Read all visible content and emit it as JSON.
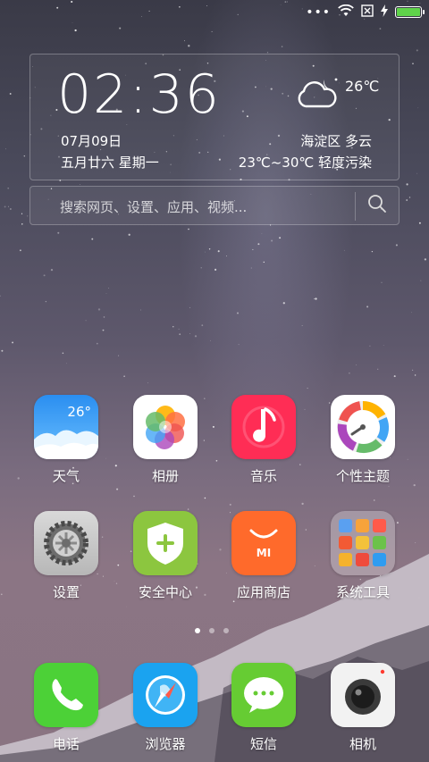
{
  "status_bar": {
    "dots": "•••",
    "icons": [
      "wifi-icon",
      "no-sim-icon",
      "charging-bolt-icon",
      "battery-icon"
    ],
    "battery_level": 1.0,
    "battery_color": "#5fd34a"
  },
  "clock_widget": {
    "time": "02:36",
    "date": "07月09日",
    "lunar_weekday": "五月廿六  星期一",
    "temperature_now": "26℃",
    "district_condition": "海淀区  多云",
    "range_air_quality": "23℃~30℃  轻度污染",
    "weather_icon": "cloudy-night-icon"
  },
  "search": {
    "placeholder": "搜索网页、设置、应用、视频...",
    "icon": "search-icon"
  },
  "apps_row1": [
    {
      "label": "天气",
      "icon": "weather-app-icon",
      "badge": "26°"
    },
    {
      "label": "相册",
      "icon": "gallery-app-icon"
    },
    {
      "label": "音乐",
      "icon": "music-app-icon"
    },
    {
      "label": "个性主题",
      "icon": "themes-app-icon"
    }
  ],
  "apps_row2": [
    {
      "label": "设置",
      "icon": "settings-app-icon"
    },
    {
      "label": "安全中心",
      "icon": "security-app-icon"
    },
    {
      "label": "应用商店",
      "icon": "app-store-icon",
      "badge": "MI"
    },
    {
      "label": "系统工具",
      "icon": "system-tools-folder-icon"
    }
  ],
  "page_indicator": {
    "pages": 3,
    "current": 1
  },
  "dock": [
    {
      "label": "电话",
      "icon": "phone-app-icon"
    },
    {
      "label": "浏览器",
      "icon": "browser-app-icon"
    },
    {
      "label": "短信",
      "icon": "messages-app-icon"
    },
    {
      "label": "相机",
      "icon": "camera-app-icon"
    }
  ],
  "colors": {
    "weather": "#2f9cf0",
    "music": "#ff2d55",
    "security": "#8cc63f",
    "app_store": "#ff6a2b",
    "phone": "#4cd137",
    "browser": "#1aa3f0",
    "messages": "#66cc33"
  }
}
